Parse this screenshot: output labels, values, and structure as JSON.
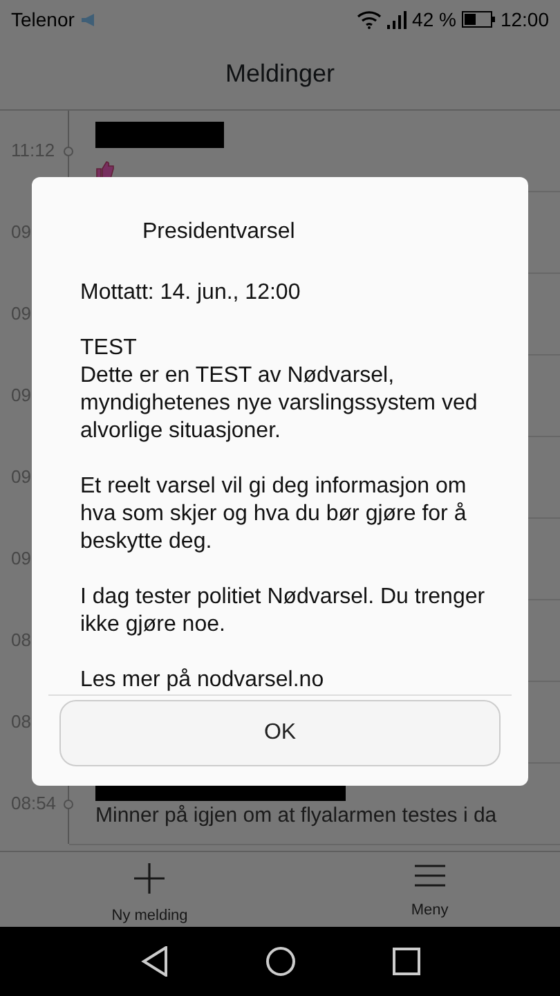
{
  "status_bar": {
    "carrier": "Telenor",
    "battery": "42 %",
    "time": "12:00"
  },
  "header": {
    "title": "Meldinger"
  },
  "messages": [
    {
      "time": "11:12",
      "kind": "emoji"
    },
    {
      "time": "09",
      "kind": "hidden"
    },
    {
      "time": "09",
      "kind": "hidden"
    },
    {
      "time": "09",
      "kind": "hidden"
    },
    {
      "time": "09",
      "kind": "hidden"
    },
    {
      "time": "09",
      "kind": "hidden"
    },
    {
      "time": "08",
      "kind": "hidden"
    },
    {
      "time": "08",
      "kind": "hidden"
    },
    {
      "time": "08:54",
      "kind": "text",
      "preview": "Minner på igjen om at flyalarmen testes i da"
    }
  ],
  "bottom_bar": [
    {
      "label": "Ny melding",
      "kind": "add"
    },
    {
      "label": "Meny",
      "kind": "menu"
    }
  ],
  "dialog": {
    "title": "Presidentvarsel",
    "paragraphs": [
      [
        "Mottatt: 14. jun., 12:00"
      ],
      [
        "TEST",
        "Dette er en TEST av Nødvarsel, myndighetenes nye varslingssystem ved alvorlige situasjoner."
      ],
      [
        "Et reelt varsel vil gi deg informasjon om hva som skjer og hva du bør gjøre for å beskytte deg."
      ],
      [
        "I dag tester politiet Nødvarsel. Du trenger ikke gjøre noe."
      ],
      [
        "Les mer på nodvarsel.no"
      ]
    ],
    "button": "OK"
  }
}
